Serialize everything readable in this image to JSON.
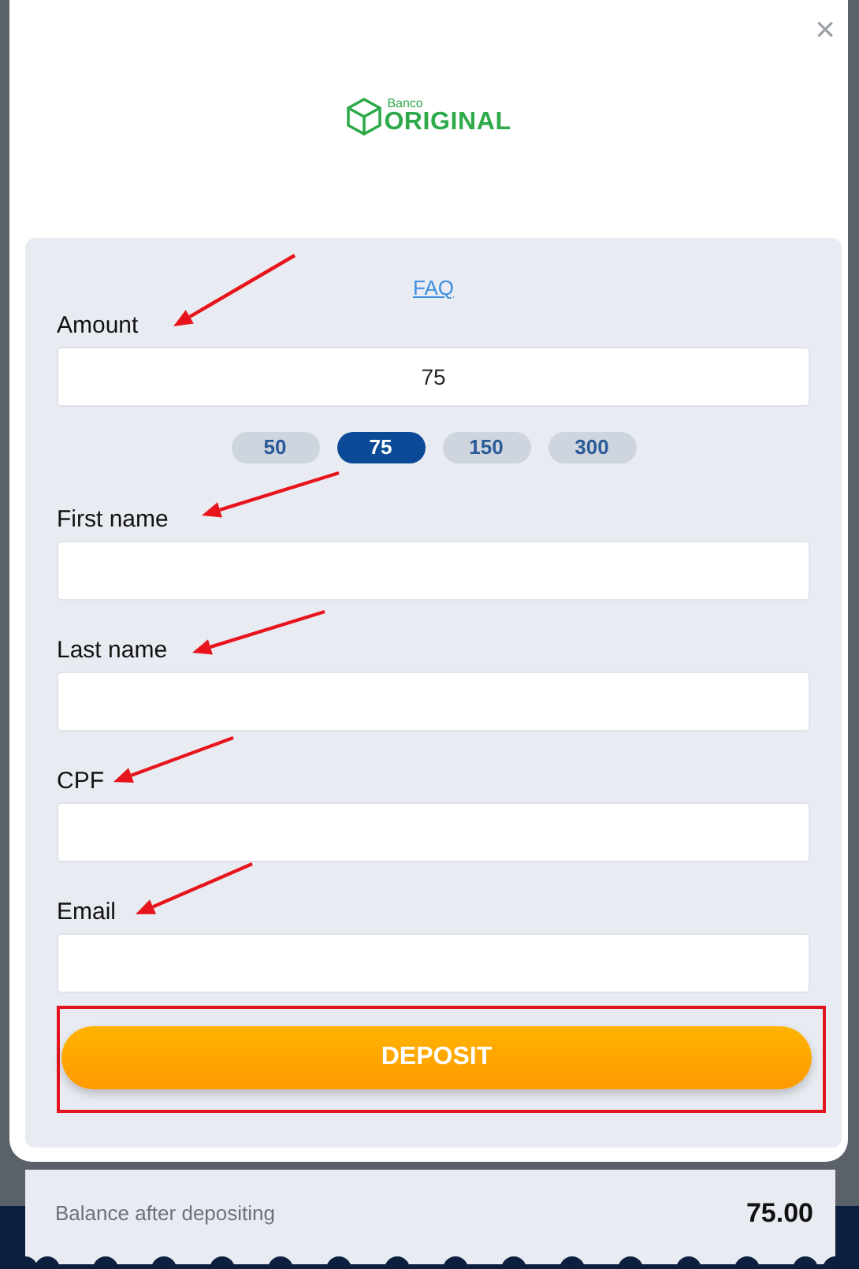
{
  "close": "×",
  "logo": {
    "small": "Banco",
    "name": "ORIGINAL"
  },
  "faq": "FAQ",
  "amount": {
    "label": "Amount",
    "value": "75",
    "presets": [
      {
        "label": "50",
        "selected": false
      },
      {
        "label": "75",
        "selected": true
      },
      {
        "label": "150",
        "selected": false
      },
      {
        "label": "300",
        "selected": false
      }
    ]
  },
  "fields": [
    {
      "label": "First name"
    },
    {
      "label": "Last name"
    },
    {
      "label": "CPF"
    },
    {
      "label": "Email"
    }
  ],
  "button": "DEPOSIT",
  "balance": {
    "label": "Balance after depositing",
    "value": "75.00"
  }
}
